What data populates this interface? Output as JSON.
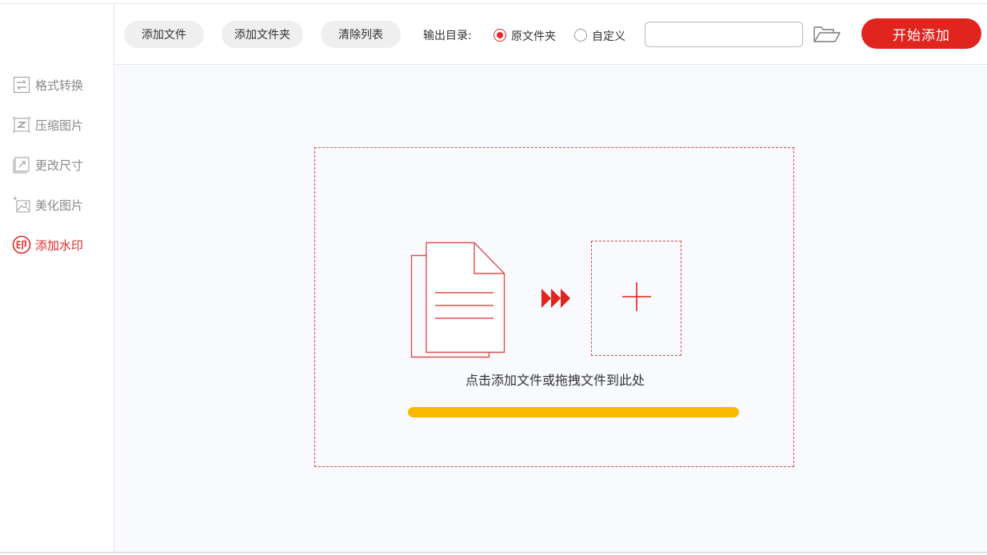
{
  "sidebar": {
    "items": [
      {
        "label": "格式转换",
        "icon": "format-convert-icon",
        "active": false
      },
      {
        "label": "压缩图片",
        "icon": "compress-image-icon",
        "active": false
      },
      {
        "label": "更改尺寸",
        "icon": "resize-icon",
        "active": false
      },
      {
        "label": "美化图片",
        "icon": "beautify-image-icon",
        "active": false
      },
      {
        "label": "添加水印",
        "icon": "watermark-icon",
        "active": true
      }
    ]
  },
  "toolbar": {
    "add_file_label": "添加文件",
    "add_folder_label": "添加文件夹",
    "clear_list_label": "清除列表",
    "output_dir_label": "输出目录:",
    "radio_original_label": "原文件夹",
    "radio_custom_label": "自定义",
    "selected_output": "原文件夹",
    "path_value": "",
    "path_placeholder": "",
    "folder_icon": "folder-open-icon",
    "start_label": "开始添加"
  },
  "main": {
    "drop_hint": "点击添加文件或拖拽文件到此处",
    "doc_icon": "document-stack-icon",
    "arrow_icon": "triple-arrow-icon",
    "add_icon": "plus-icon",
    "progress_fraction": 1.0
  },
  "colors": {
    "accent": "#e0241e",
    "active_text": "#e02a2a",
    "inactive_text": "#8a8a8a",
    "progress": "#fbb900",
    "dashed_border": "#d94848",
    "main_bg": "#f8fafd"
  }
}
